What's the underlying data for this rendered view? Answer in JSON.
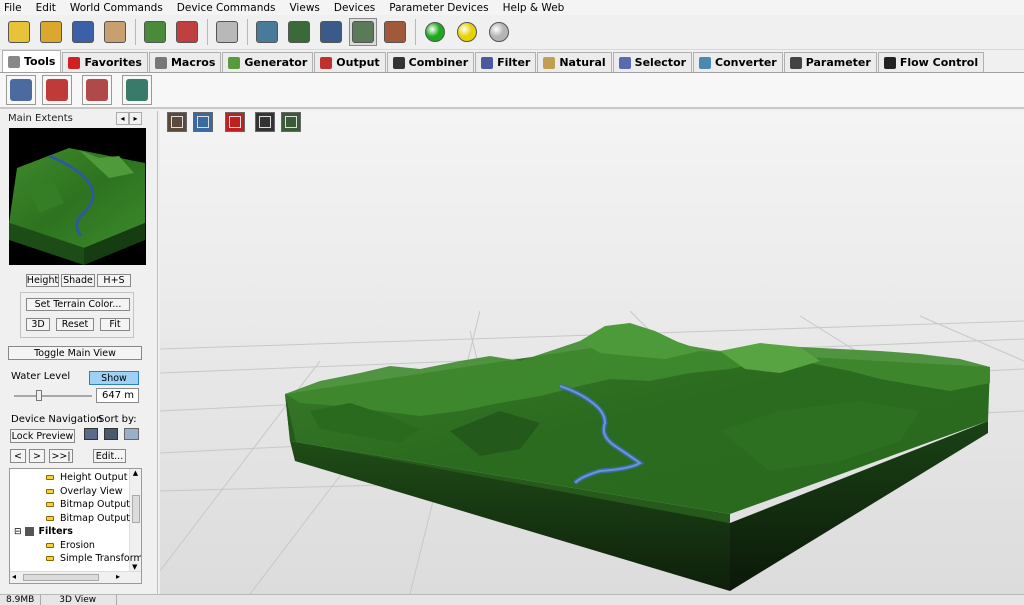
{
  "menu": [
    "File",
    "Edit",
    "World Commands",
    "Device Commands",
    "Views",
    "Devices",
    "Parameter Devices",
    "Help & Web"
  ],
  "toolbar_icons": [
    {
      "name": "new-world-icon",
      "color": "#e8c238"
    },
    {
      "name": "open-folder-icon",
      "color": "#d9a82c"
    },
    {
      "name": "save-icon",
      "color": "#3b5fa8"
    },
    {
      "name": "hand-tool-icon",
      "color": "#c8a070"
    },
    {
      "name": "terrain-graph-icon",
      "color": "#4a8a3a"
    },
    {
      "name": "script-icon",
      "color": "#c04040"
    },
    {
      "name": "random-dice-icon",
      "color": "#b8b8b8"
    },
    {
      "name": "layout-view-icon",
      "color": "#4a7a9a"
    },
    {
      "name": "grid-view-icon",
      "color": "#3a6a3a"
    },
    {
      "name": "globe-view-icon",
      "color": "#3a5a8a"
    },
    {
      "name": "3d-view-icon",
      "color": "#5a7a5a"
    },
    {
      "name": "texture-view-icon",
      "color": "#a05a3a"
    }
  ],
  "status_balls": [
    {
      "name": "build-green-icon",
      "color": "#1fa81f"
    },
    {
      "name": "build-yellow-icon",
      "color": "#e8d200"
    },
    {
      "name": "build-gray-icon",
      "color": "#b4b4b4"
    }
  ],
  "tabs": [
    {
      "label": "Tools",
      "color": "#888"
    },
    {
      "label": "Favorites",
      "color": "#d02020"
    },
    {
      "label": "Macros",
      "color": "#777"
    },
    {
      "label": "Generator",
      "color": "#5a9a3a"
    },
    {
      "label": "Output",
      "color": "#c03030"
    },
    {
      "label": "Combiner",
      "color": "#333"
    },
    {
      "label": "Filter",
      "color": "#4a5aa0"
    },
    {
      "label": "Natural",
      "color": "#c0a050"
    },
    {
      "label": "Selector",
      "color": "#5a6ab0"
    },
    {
      "label": "Converter",
      "color": "#4a8ab0"
    },
    {
      "label": "Parameter",
      "color": "#444"
    },
    {
      "label": "Flow Control",
      "color": "#222"
    }
  ],
  "tools_icons": [
    {
      "name": "layout-tool-icon",
      "color": "#4a6aa0"
    },
    {
      "name": "group-tool-icon",
      "color": "#c03a3a"
    },
    {
      "name": "export-tool-icon",
      "color": "#b04a4a"
    },
    {
      "name": "macro-tool-icon",
      "color": "#3a7a6a"
    }
  ],
  "view_tools": [
    {
      "name": "orbit-mode-icon",
      "color": "#5a4a3a"
    },
    {
      "name": "free-mode-icon",
      "color": "#3a6aa0"
    },
    {
      "name": "reset-view-icon",
      "color": "#c02020"
    },
    {
      "name": "camera-snapshot-icon",
      "color": "#333333"
    },
    {
      "name": "wireframe-toggle-icon",
      "color": "#3a5a3a"
    }
  ],
  "left": {
    "title": "Main Extents",
    "height_btn": "Height",
    "shade_btn": "Shade",
    "hs_btn": "H+S",
    "set_color_btn": "Set Terrain Color...",
    "btn_3d": "3D",
    "reset_btn": "Reset",
    "fit_btn": "Fit",
    "toggle_btn": "Toggle Main View",
    "water_label": "Water Level",
    "show_btn": "Show",
    "water_value": "647 m",
    "water_slider_level": 0.3,
    "nav_label": "Device Navigation",
    "sortby_label": "Sort by:",
    "lock_btn": "Lock Preview",
    "prev_btn": "<",
    "next_btn": ">",
    "last_btn": ">>|",
    "edit_btn": "Edit...",
    "tree": [
      {
        "label": "Height Output",
        "type": "leaf"
      },
      {
        "label": "Overlay View",
        "type": "leaf"
      },
      {
        "label": "Bitmap Output",
        "type": "leaf"
      },
      {
        "label": "Bitmap Output",
        "type": "leaf"
      },
      {
        "label": "Filters",
        "type": "group"
      },
      {
        "label": "Erosion",
        "type": "leaf"
      },
      {
        "label": "Simple Transform",
        "type": "leaf"
      }
    ]
  },
  "status": [
    "8.9MB",
    "3D View"
  ]
}
